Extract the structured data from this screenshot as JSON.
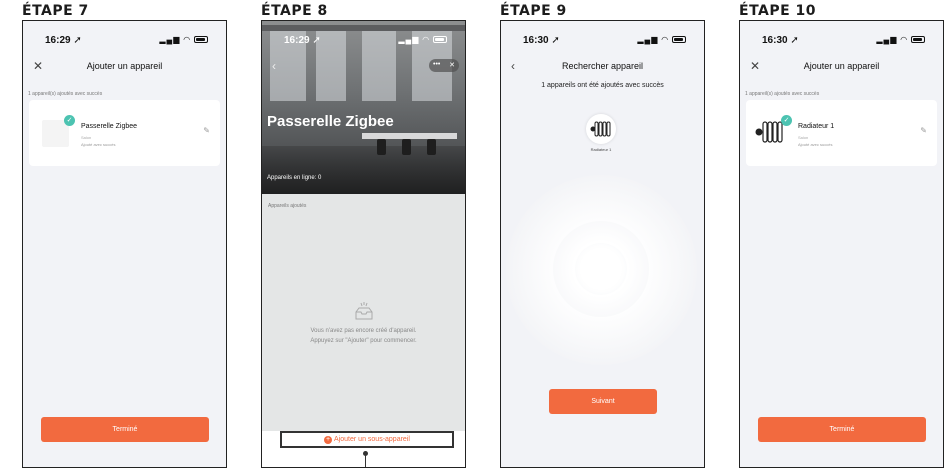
{
  "steps": [
    {
      "title": "ÉTAPE 7",
      "time": "16:29",
      "nav_title": "Ajouter un appareil",
      "close_glyph": "✕",
      "success_caption": "1 appareil(s) ajoutés avec succès",
      "device": {
        "name": "Passerelle Zigbee",
        "room": "Salon",
        "status": "Ajouté avec succès"
      },
      "done_label": "Terminé"
    },
    {
      "title": "ÉTAPE 8",
      "time": "16:29",
      "hero_title": "Passerelle Zigbee",
      "online_label": "Appareils en ligne: 0",
      "added_label": "Appareils ajoutés",
      "empty_line1": "Vous n'avez pas encore créé d'appareil.",
      "empty_line2": "Appuyez sur \"Ajouter\" pour commencer.",
      "add_sub_label": "Ajouter un sous-appareil",
      "menu_dots": "•••",
      "menu_close": "✕"
    },
    {
      "title": "ÉTAPE 9",
      "time": "16:30",
      "nav_title": "Rechercher appareil",
      "header": "1 appareils ont été ajoutés avec succès",
      "found_label": "Radiateur 1",
      "next_label": "Suivant"
    },
    {
      "title": "ÉTAPE 10",
      "time": "16:30",
      "nav_title": "Ajouter un appareil",
      "close_glyph": "✕",
      "success_caption": "1 appareil(s) ajoutés avec succès",
      "device": {
        "name": "Radiateur 1",
        "room": "Salon",
        "status": "Ajouté avec succès"
      },
      "done_label": "Terminé"
    }
  ],
  "colors": {
    "accent": "#f26a3f",
    "success": "#4cc3b1",
    "background": "#f2f3f7"
  },
  "icons": {
    "location": "➚",
    "signal": "▂▄▆",
    "wifi": "◠",
    "back": "‹",
    "edit": "✎",
    "check": "✓"
  }
}
